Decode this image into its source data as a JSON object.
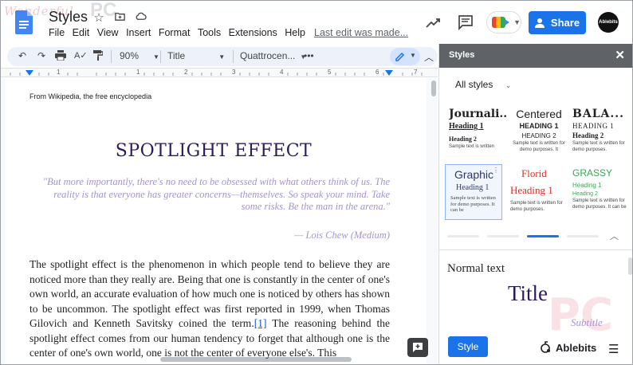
{
  "header": {
    "doc_title": "Styles",
    "menu": [
      "File",
      "Edit",
      "View",
      "Insert",
      "Format",
      "Tools",
      "Extensions",
      "Help"
    ],
    "last_edit": "Last edit was made...",
    "share_label": "Share",
    "avatar_label": "Ablebits",
    "watermark_script": "Wonderful",
    "watermark_pc": "PC"
  },
  "toolbar": {
    "zoom": "90%",
    "style": "Title",
    "font": "Quattrocen...",
    "more": "•••"
  },
  "ruler": {
    "numbers": [
      "1",
      "1",
      "2",
      "3",
      "4",
      "5",
      "6",
      "7"
    ]
  },
  "document": {
    "source": "From Wikipedia, the free encyclopedia",
    "heading": "SPOTLIGHT EFFECT",
    "quote": "\"But more importantly, there's no need to be obsessed with what others think of us. The reality is that everyone has greater concerns—themselves. So speak your mind. Take some risks. Be the man in the arena.\"",
    "quote_author": "— Lois Chew (Medium)",
    "body_before_link": "The spotlight effect is the phenomenon in which people tend to believe they are noticed more than they really are. Being that one is constantly in the center of one's own world, an accurate evaluation of how much one is noticed by others has shown to be uncommon. The spotlight effect was first reported in 1999, when Thomas Gilovich and Kenneth Savitsky coined the term.",
    "body_link": "[1]",
    "body_after_link": " The reasoning behind the spotlight effect comes from our human tendency to forget that although one is the center of one's own world, one is not the center of everyone else's. This"
  },
  "panel": {
    "title": "Styles",
    "close": "✕",
    "filter": "All styles",
    "tiles": [
      {
        "title": "Journali...",
        "h1": "Heading 1",
        "h2": "Heading 2",
        "body": "Sample text is written"
      },
      {
        "title": "Centered",
        "h1": "HEADING 1",
        "h2": "HEADING 2",
        "body": "Sample text is written for demo purposes. It"
      },
      {
        "title": "BALA...",
        "h1": "HEADING 1",
        "h2": "Heading 2",
        "body": "Sample text is written for demo purposes."
      },
      {
        "title": "Graphic",
        "h1": "Heading 1",
        "h2": "",
        "body": "Sample text is written for demo purposes. It can be"
      },
      {
        "title": "Florid",
        "h1": "Heading 1",
        "h2": "",
        "body": "Sample text is written for demo purposes."
      },
      {
        "title": "GRASSY",
        "h1": "Heading 1",
        "h2": "Heading 2",
        "body": "Sample text is written for demo purposes. It can be"
      }
    ],
    "preview_normal": "Normal text",
    "preview_title": "Title",
    "preview_subtitle": "Subtitle",
    "preview_watermark": "PC",
    "style_button": "Style",
    "brand": "Ablebits"
  },
  "colors": {
    "accent": "#1a73e8",
    "heading": "#2a1a5e",
    "quote": "#a492d6",
    "florid": "#d93025",
    "grassy": "#34a853"
  }
}
